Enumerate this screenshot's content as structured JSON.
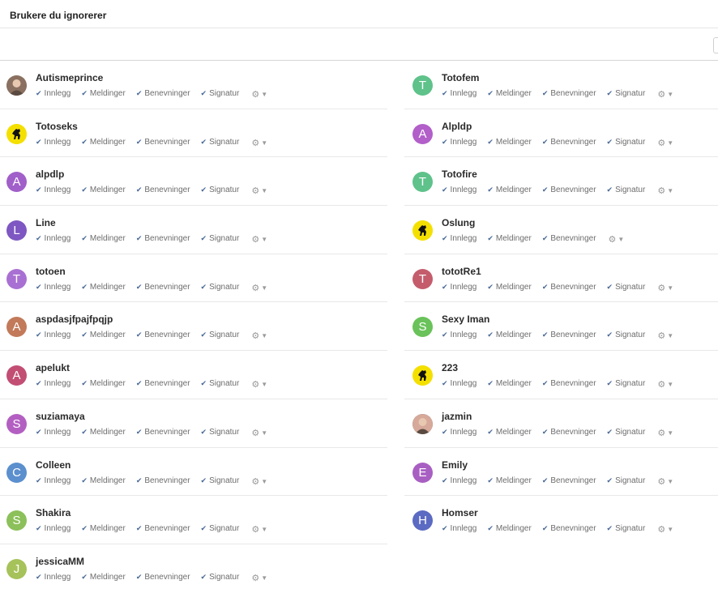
{
  "header": {
    "title": "Brukere du ignorerer"
  },
  "labels": {
    "innlegg": "Innlegg",
    "meldinger": "Meldinger",
    "benevninger": "Benevninger",
    "signatur": "Signatur"
  },
  "icons": {
    "check": "check-icon",
    "gear": "gear-icon",
    "caret": "chevron-down-icon"
  },
  "users_left": [
    {
      "name": "Autismeprince",
      "avatar": "",
      "avatar_type": "photo",
      "avatar_color": "#8a7060",
      "show_signatur": true
    },
    {
      "name": "Totoseks",
      "avatar": "",
      "avatar_type": "horse",
      "avatar_color": "#f4e000",
      "show_signatur": true
    },
    {
      "name": "alpdlp",
      "avatar": "A",
      "avatar_type": "letter",
      "avatar_color": "#a15fc9",
      "show_signatur": true
    },
    {
      "name": "Line",
      "avatar": "L",
      "avatar_type": "letter",
      "avatar_color": "#7e57c2",
      "show_signatur": true
    },
    {
      "name": "totoen",
      "avatar": "T",
      "avatar_type": "letter",
      "avatar_color": "#a970d3",
      "show_signatur": true
    },
    {
      "name": "aspdasjfpajfpqjp",
      "avatar": "A",
      "avatar_type": "letter",
      "avatar_color": "#c27a5a",
      "show_signatur": true
    },
    {
      "name": "apelukt",
      "avatar": "A",
      "avatar_type": "letter",
      "avatar_color": "#c24e74",
      "show_signatur": true
    },
    {
      "name": "suziamaya",
      "avatar": "S",
      "avatar_type": "letter",
      "avatar_color": "#b35fc2",
      "show_signatur": true
    },
    {
      "name": "Colleen",
      "avatar": "C",
      "avatar_type": "letter",
      "avatar_color": "#5b8fce",
      "show_signatur": true
    },
    {
      "name": "Shakira",
      "avatar": "S",
      "avatar_type": "letter",
      "avatar_color": "#8cc05a",
      "show_signatur": true
    },
    {
      "name": "jessicaMM",
      "avatar": "J",
      "avatar_type": "letter",
      "avatar_color": "#a6c25a",
      "show_signatur": true
    }
  ],
  "users_right": [
    {
      "name": "Totofem",
      "avatar": "T",
      "avatar_type": "letter",
      "avatar_color": "#5ec28a",
      "show_signatur": true
    },
    {
      "name": "Alpldp",
      "avatar": "A",
      "avatar_type": "letter",
      "avatar_color": "#b25fc9",
      "show_signatur": true
    },
    {
      "name": "Totofire",
      "avatar": "T",
      "avatar_type": "letter",
      "avatar_color": "#5ec28a",
      "show_signatur": true
    },
    {
      "name": "Oslung",
      "avatar": "",
      "avatar_type": "horse",
      "avatar_color": "#f4e000",
      "show_signatur": false
    },
    {
      "name": "tototRe1",
      "avatar": "T",
      "avatar_type": "letter",
      "avatar_color": "#c45c6c",
      "show_signatur": true
    },
    {
      "name": "Sexy Iman",
      "avatar": "S",
      "avatar_type": "letter",
      "avatar_color": "#6ac25a",
      "show_signatur": true
    },
    {
      "name": "223",
      "avatar": "",
      "avatar_type": "horse",
      "avatar_color": "#f4e000",
      "show_signatur": true
    },
    {
      "name": "jazmin",
      "avatar": "",
      "avatar_type": "photo",
      "avatar_color": "#d6a99a",
      "show_signatur": true
    },
    {
      "name": "Emily",
      "avatar": "E",
      "avatar_type": "letter",
      "avatar_color": "#a85fc2",
      "show_signatur": true
    },
    {
      "name": "Homser",
      "avatar": "H",
      "avatar_type": "letter",
      "avatar_color": "#5b6ac2",
      "show_signatur": true
    }
  ]
}
